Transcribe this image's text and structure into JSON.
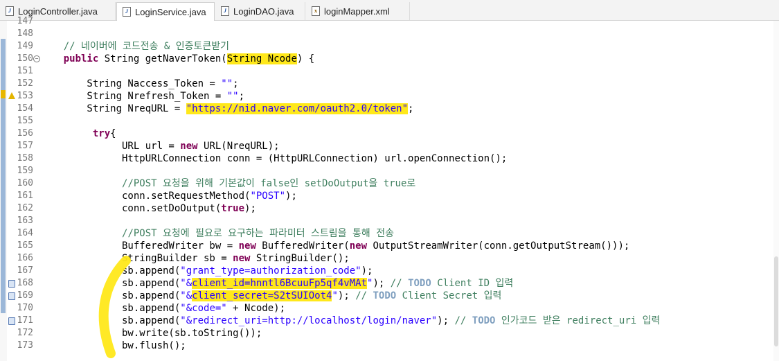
{
  "tabs": [
    {
      "label": "LoginController.java",
      "icon": "java-file-icon",
      "active": false
    },
    {
      "label": "LoginService.java",
      "icon": "java-file-icon",
      "active": true
    },
    {
      "label": "LoginDAO.java",
      "icon": "java-file-icon",
      "active": false
    },
    {
      "label": "loginMapper.xml",
      "icon": "xml-file-icon",
      "active": false
    }
  ],
  "editor": {
    "line_numbers": [
      "147",
      "148",
      "149",
      "150",
      "151",
      "152",
      "153",
      "154",
      "155",
      "156",
      "157",
      "158",
      "159",
      "160",
      "161",
      "162",
      "163",
      "164",
      "165",
      "166",
      "167",
      "168",
      "169",
      "170",
      "171",
      "172",
      "173"
    ],
    "lines": [
      "",
      "",
      "    // 네이버에 코드전송 & 인증토큰받기",
      "    public String getNaverToken(String Ncode) {",
      "",
      "        String Naccess_Token = \"\";",
      "        String Nrefresh_Token = \"\";",
      "        String NreqURL = \"https://nid.naver.com/oauth2.0/token\";",
      "",
      "         try{",
      "              URL url = new URL(NreqURL);",
      "              HttpURLConnection conn = (HttpURLConnection) url.openConnection();",
      "",
      "              //POST 요청을 위해 기본값이 false인 setDoOutput을 true로",
      "              conn.setRequestMethod(\"POST\");",
      "              conn.setDoOutput(true);",
      "",
      "              //POST 요청에 필요로 요구하는 파라미터 스트림을 통해 전송",
      "              BufferedWriter bw = new BufferedWriter(new OutputStreamWriter(conn.getOutputStream()));",
      "              StringBuilder sb = new StringBuilder();",
      "              sb.append(\"grant_type=authorization_code\");",
      "              sb.append(\"&client_id=hnntl6BcuuFp5qf4vMAt\"); // TODO Client ID 입력",
      "              sb.append(\"&client_secret=S2tSUIOot4\"); // TODO Client Secret 입력",
      "              sb.append(\"&code=\" + Ncode);",
      "              sb.append(\"&redirect_uri=http://localhost/login/naver\"); // TODO 인가코드 받은 redirect_uri 입력",
      "              bw.write(sb.toString());",
      "              bw.flush();"
    ]
  },
  "colors": {
    "keyword": "#7f0055",
    "comment": "#3f7f5f",
    "string": "#2a00ff",
    "todo": "#7f9fbf",
    "highlight": "#ffe81a"
  }
}
